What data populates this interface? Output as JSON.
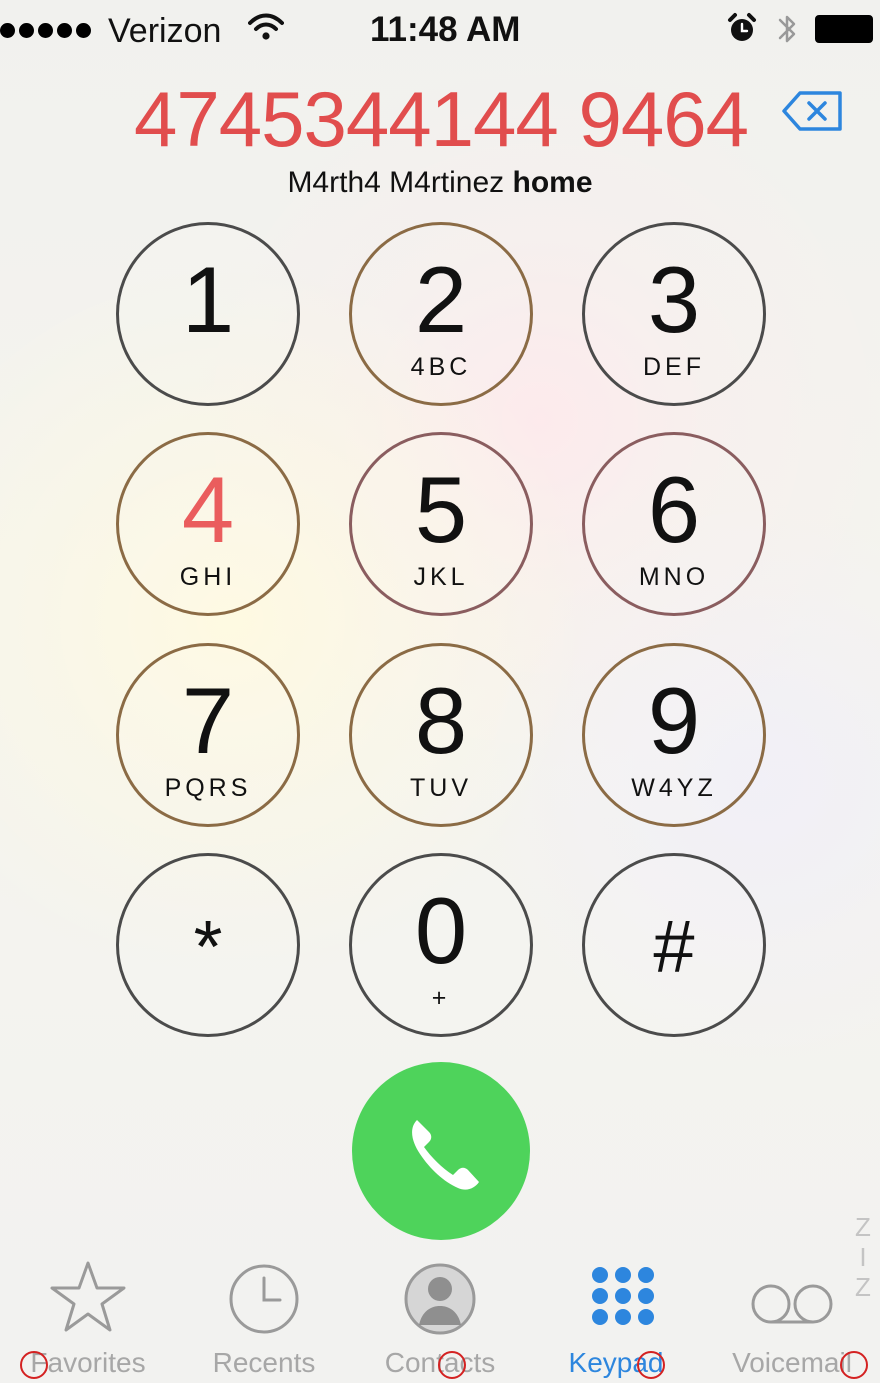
{
  "status_bar": {
    "carrier": "Verizon",
    "time": "11:48 AM",
    "signal_bars": 5
  },
  "dialer": {
    "dialed_number": "4745344144 9464",
    "contact_name": "M4rth4 M4rtinez",
    "contact_label": "home",
    "backspace_icon": "backspace-icon"
  },
  "keypad": {
    "keys": [
      {
        "digit": "1",
        "letters": ""
      },
      {
        "digit": "2",
        "letters": "4BC"
      },
      {
        "digit": "3",
        "letters": "DEF"
      },
      {
        "digit": "4",
        "letters": "GHI"
      },
      {
        "digit": "5",
        "letters": "JKL"
      },
      {
        "digit": "6",
        "letters": "MNO"
      },
      {
        "digit": "7",
        "letters": "PQRS"
      },
      {
        "digit": "8",
        "letters": "TUV"
      },
      {
        "digit": "9",
        "letters": "W4YZ"
      },
      {
        "digit": "*",
        "letters": ""
      },
      {
        "digit": "0",
        "letters": "+"
      },
      {
        "digit": "#",
        "letters": ""
      }
    ]
  },
  "call": {
    "icon": "phone-icon",
    "color": "#4ed35b"
  },
  "tabs": [
    {
      "label": "Favorites",
      "icon": "star-icon"
    },
    {
      "label": "Recents",
      "icon": "clock-icon"
    },
    {
      "label": "Contacts",
      "icon": "contact-icon"
    },
    {
      "label": "Keypad",
      "icon": "keypad-icon",
      "active": true
    },
    {
      "label": "Voicemail",
      "icon": "voicemail-icon"
    }
  ],
  "colors": {
    "accent_red": "#e14d4d",
    "active_tab": "#2d86de",
    "inactive_tab": "#a7a7a7",
    "call_green": "#4ed35b"
  }
}
